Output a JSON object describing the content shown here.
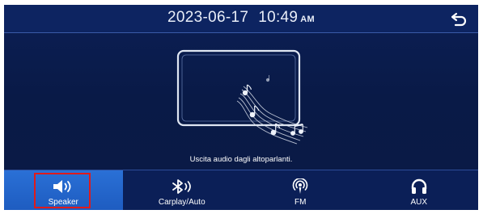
{
  "header": {
    "date": "2023-06-17",
    "time": "10:49",
    "ampm": "AM"
  },
  "status_text": "Uscita audio dagli altoparlanti.",
  "tabs": [
    {
      "label": "Speaker",
      "icon": "speaker-icon",
      "active": true
    },
    {
      "label": "Carplay/Auto",
      "icon": "bluetooth-audio-icon",
      "active": false
    },
    {
      "label": "FM",
      "icon": "radio-antenna-icon",
      "active": false
    },
    {
      "label": "AUX",
      "icon": "headphones-icon",
      "active": false
    }
  ],
  "colors": {
    "background": "#0a1b4a",
    "active_tab": "#2a70d6",
    "highlight": "#e01b1b"
  }
}
